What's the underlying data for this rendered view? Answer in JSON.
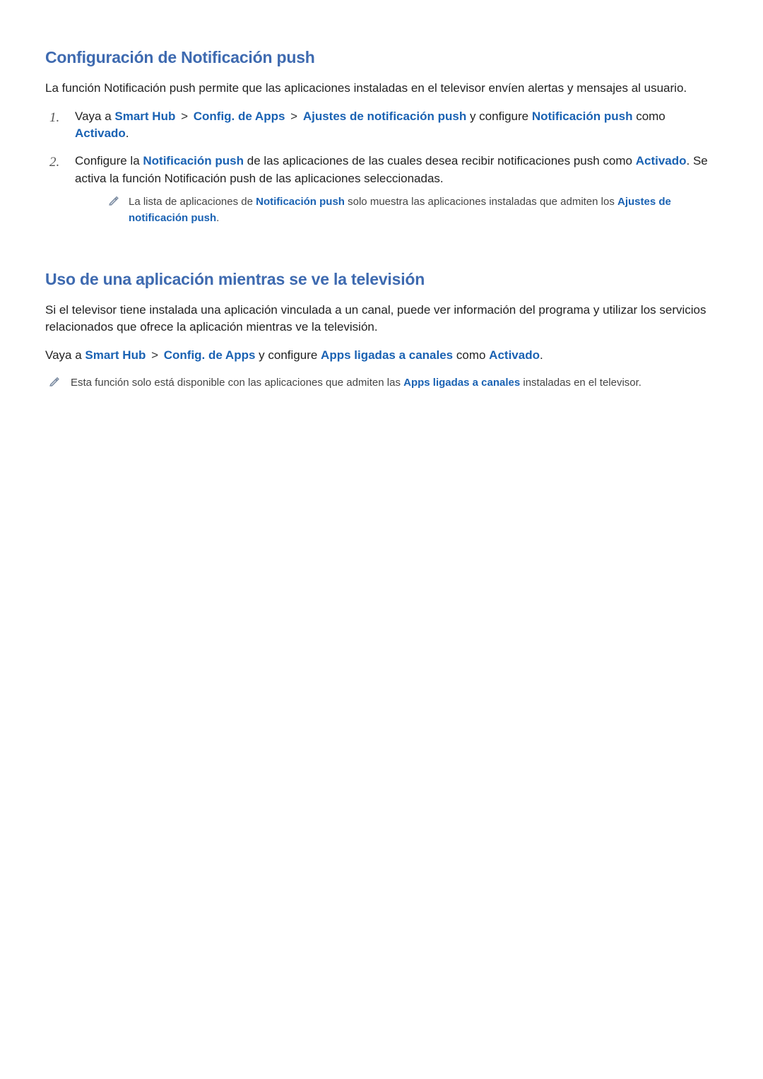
{
  "section1": {
    "heading": "Configuración de Notificación push",
    "intro": "La función Notificación push permite que las aplicaciones instaladas en el televisor envíen alertas y mensajes al usuario.",
    "step1": {
      "num": "1.",
      "t1": "Vaya a ",
      "link1": "Smart Hub",
      "sep1": " > ",
      "link2": "Config. de Apps",
      "sep2": " > ",
      "link3": "Ajustes de notificación push",
      "t2": " y configure ",
      "link4": "Notificación push",
      "t3": " como ",
      "link5": "Activado",
      "t4": "."
    },
    "step2": {
      "num": "2.",
      "t1": "Configure la ",
      "link1": "Notificación push",
      "t2": " de las aplicaciones de las cuales desea recibir notificaciones push como ",
      "link2": "Activado",
      "t3": ". Se activa la función Notificación push de las aplicaciones seleccionadas."
    },
    "note1": {
      "t1": "La lista de aplicaciones de ",
      "link1": "Notificación push",
      "t2": " solo muestra las aplicaciones instaladas que admiten los ",
      "link2": "Ajustes de notificación push",
      "t3": "."
    }
  },
  "section2": {
    "heading": "Uso de una aplicación mientras se ve la televisión",
    "intro": "Si el televisor tiene instalada una aplicación vinculada a un canal, puede ver información del programa y utilizar los servicios relacionados que ofrece la aplicación mientras ve la televisión.",
    "path": {
      "t1": "Vaya a ",
      "link1": "Smart Hub",
      "sep1": " > ",
      "link2": "Config. de Apps",
      "t2": " y configure ",
      "link3": "Apps ligadas a canales",
      "t3": " como ",
      "link4": "Activado",
      "t4": "."
    },
    "note1": {
      "t1": "Esta función solo está disponible con las aplicaciones que admiten las ",
      "link1": "Apps ligadas a canales",
      "t2": " instaladas en el televisor."
    }
  }
}
